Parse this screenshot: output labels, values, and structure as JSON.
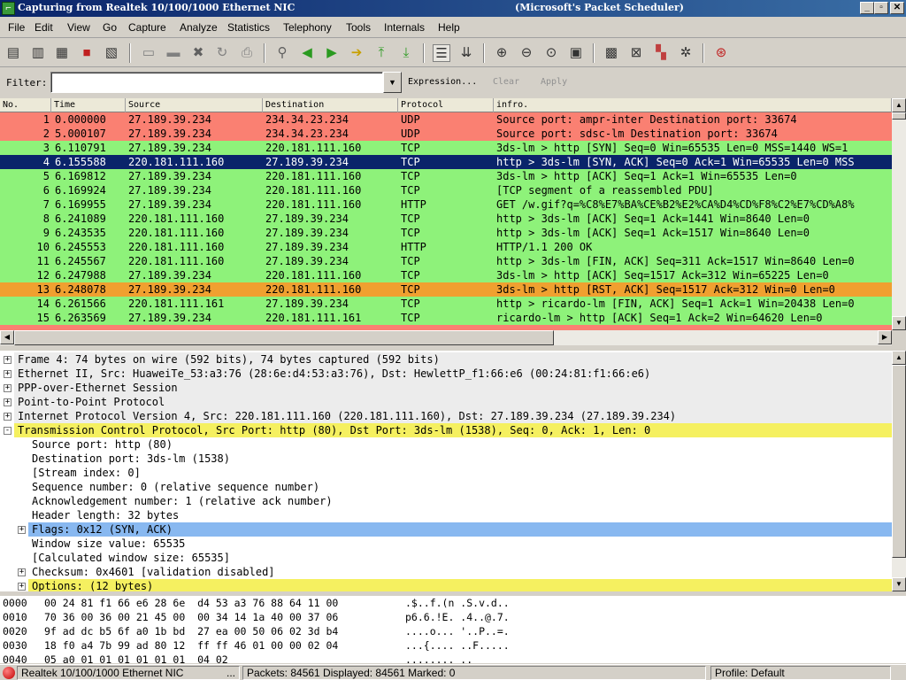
{
  "window": {
    "title": "Capturing from Realtek 10/100/1000 Ethernet NIC",
    "subtitle": "(Microsoft's Packet Scheduler)",
    "minimize": "_",
    "restore": "▫",
    "close": "✕"
  },
  "menu": {
    "file": "File",
    "edit": "Edit",
    "view": "View",
    "go": "Go",
    "capture": "Capture",
    "analyze": "Analyze",
    "statistics": "Statistics",
    "telephony": "Telephony",
    "tools": "Tools",
    "internals": "Internals",
    "help": "Help"
  },
  "filter": {
    "label": "Filter:",
    "value": "",
    "expression": "Expression...",
    "clear": "Clear",
    "apply": "Apply"
  },
  "packet_list": {
    "headers": {
      "no": "No.",
      "time": "Time",
      "source": "Source",
      "destination": "Destination",
      "protocol": "Protocol",
      "info": "infro."
    },
    "rows": [
      {
        "no": "1",
        "time": "0.000000",
        "src": "27.189.39.234",
        "dst": "234.34.23.234",
        "proto": "UDP",
        "info": "Source port: ampr-inter  Destination port: 33674",
        "bg": "#fa8072",
        "fg": "#000000"
      },
      {
        "no": "2",
        "time": "5.000107",
        "src": "27.189.39.234",
        "dst": "234.34.23.234",
        "proto": "UDP",
        "info": "Source port: sdsc-lm  Destination port: 33674",
        "bg": "#fa8072",
        "fg": "#000000"
      },
      {
        "no": "3",
        "time": "6.110791",
        "src": "27.189.39.234",
        "dst": "220.181.111.160",
        "proto": "TCP",
        "info": "3ds-lm > http [SYN] Seq=0 Win=65535 Len=0 MSS=1440 WS=1",
        "bg": "#8ef27a",
        "fg": "#000000"
      },
      {
        "no": "4",
        "time": "6.155588",
        "src": "220.181.111.160",
        "dst": "27.189.39.234",
        "proto": "TCP",
        "info": "http > 3ds-lm [SYN, ACK] Seq=0 Ack=1 Win=65535 Len=0 MSS",
        "bg": "#0a246a",
        "fg": "#ffffff"
      },
      {
        "no": "5",
        "time": "6.169812",
        "src": "27.189.39.234",
        "dst": "220.181.111.160",
        "proto": "TCP",
        "info": "3ds-lm > http [ACK] Seq=1 Ack=1 Win=65535 Len=0",
        "bg": "#8ef27a",
        "fg": "#000000"
      },
      {
        "no": "6",
        "time": "6.169924",
        "src": "27.189.39.234",
        "dst": "220.181.111.160",
        "proto": "TCP",
        "info": "[TCP segment of a reassembled PDU]",
        "bg": "#8ef27a",
        "fg": "#000000"
      },
      {
        "no": "7",
        "time": "6.169955",
        "src": "27.189.39.234",
        "dst": "220.181.111.160",
        "proto": "HTTP",
        "info": "GET /w.gif?q=%C8%E7%BA%CE%B2%E2%CA%D4%CD%F8%C2%E7%CD%A8%",
        "bg": "#8ef27a",
        "fg": "#000000"
      },
      {
        "no": "8",
        "time": "6.241089",
        "src": "220.181.111.160",
        "dst": "27.189.39.234",
        "proto": "TCP",
        "info": "http > 3ds-lm [ACK] Seq=1 Ack=1441 Win=8640 Len=0",
        "bg": "#8ef27a",
        "fg": "#000000"
      },
      {
        "no": "9",
        "time": "6.243535",
        "src": "220.181.111.160",
        "dst": "27.189.39.234",
        "proto": "TCP",
        "info": "http > 3ds-lm [ACK] Seq=1 Ack=1517 Win=8640 Len=0",
        "bg": "#8ef27a",
        "fg": "#000000"
      },
      {
        "no": "10",
        "time": "6.245553",
        "src": "220.181.111.160",
        "dst": "27.189.39.234",
        "proto": "HTTP",
        "info": "HTTP/1.1 200 OK",
        "bg": "#8ef27a",
        "fg": "#000000"
      },
      {
        "no": "11",
        "time": "6.245567",
        "src": "220.181.111.160",
        "dst": "27.189.39.234",
        "proto": "TCP",
        "info": "http > 3ds-lm [FIN, ACK] Seq=311 Ack=1517 Win=8640 Len=0",
        "bg": "#8ef27a",
        "fg": "#000000"
      },
      {
        "no": "12",
        "time": "6.247988",
        "src": "27.189.39.234",
        "dst": "220.181.111.160",
        "proto": "TCP",
        "info": "3ds-lm > http [ACK] Seq=1517 Ack=312 Win=65225 Len=0",
        "bg": "#8ef27a",
        "fg": "#000000"
      },
      {
        "no": "13",
        "time": "6.248078",
        "src": "27.189.39.234",
        "dst": "220.181.111.160",
        "proto": "TCP",
        "info": "3ds-lm > http [RST, ACK] Seq=1517 Ack=312 Win=0 Len=0",
        "bg": "#f0a030",
        "fg": "#000000"
      },
      {
        "no": "14",
        "time": "6.261566",
        "src": "220.181.111.161",
        "dst": "27.189.39.234",
        "proto": "TCP",
        "info": "http > ricardo-lm [FIN, ACK] Seq=1 Ack=1 Win=20438 Len=0",
        "bg": "#8ef27a",
        "fg": "#000000"
      },
      {
        "no": "15",
        "time": "6.263569",
        "src": "27.189.39.234",
        "dst": "220.181.111.161",
        "proto": "TCP",
        "info": "ricardo-lm > http [ACK] Seq=1 Ack=2 Win=64620 Len=0",
        "bg": "#8ef27a",
        "fg": "#000000"
      }
    ]
  },
  "details": [
    {
      "text": "Frame 4: 74 bytes on wire (592 bits), 74 bytes captured (592 bits)",
      "exp": "+",
      "indent": 0,
      "bg": "#ececec"
    },
    {
      "text": "Ethernet II, Src: HuaweiTe_53:a3:76 (28:6e:d4:53:a3:76), Dst: HewlettP_f1:66:e6 (00:24:81:f1:66:e6)",
      "exp": "+",
      "indent": 0,
      "bg": "#ececec"
    },
    {
      "text": "PPP-over-Ethernet Session",
      "exp": "+",
      "indent": 0,
      "bg": "#ececec"
    },
    {
      "text": "Point-to-Point Protocol",
      "exp": "+",
      "indent": 0,
      "bg": "#ececec"
    },
    {
      "text": "Internet Protocol Version 4, Src: 220.181.111.160 (220.181.111.160), Dst: 27.189.39.234 (27.189.39.234)",
      "exp": "+",
      "indent": 0,
      "bg": "#ececec"
    },
    {
      "text": "Transmission Control Protocol, Src Port: http (80), Dst Port: 3ds-lm (1538), Seq: 0, Ack: 1, Len: 0",
      "exp": "-",
      "indent": 0,
      "bg": "#f5f060"
    },
    {
      "text": "Source port: http (80)",
      "exp": "",
      "indent": 1,
      "bg": "#ffffff"
    },
    {
      "text": "Destination port: 3ds-lm (1538)",
      "exp": "",
      "indent": 1,
      "bg": "#ffffff"
    },
    {
      "text": "[Stream index: 0]",
      "exp": "",
      "indent": 1,
      "bg": "#ffffff"
    },
    {
      "text": "Sequence number: 0    (relative sequence number)",
      "exp": "",
      "indent": 1,
      "bg": "#ffffff"
    },
    {
      "text": "Acknowledgement number: 1    (relative ack number)",
      "exp": "",
      "indent": 1,
      "bg": "#ffffff"
    },
    {
      "text": "Header length: 32 bytes",
      "exp": "",
      "indent": 1,
      "bg": "#ffffff"
    },
    {
      "text": "Flags: 0x12 (SYN, ACK)",
      "exp": "+",
      "indent": 1,
      "bg": "#88b8f0"
    },
    {
      "text": "Window size value: 65535",
      "exp": "",
      "indent": 1,
      "bg": "#ffffff"
    },
    {
      "text": "[Calculated window size: 65535]",
      "exp": "",
      "indent": 1,
      "bg": "#ffffff"
    },
    {
      "text": "Checksum: 0x4601 [validation disabled]",
      "exp": "+",
      "indent": 1,
      "bg": "#ffffff"
    },
    {
      "text": "Options: (12 bytes)",
      "exp": "+",
      "indent": 1,
      "bg": "#f5f060"
    }
  ],
  "hex": [
    {
      "offset": "0000",
      "bytes": "00 24 81 f1 66 e6 28 6e  d4 53 a3 76 88 64 11 00",
      "ascii": ".$..f.(n .S.v.d.."
    },
    {
      "offset": "0010",
      "bytes": "70 36 00 36 00 21 45 00  00 34 14 1a 40 00 37 06",
      "ascii": "p6.6.!E. .4..@.7."
    },
    {
      "offset": "0020",
      "bytes": "9f ad dc b5 6f a0 1b bd  27 ea 00 50 06 02 3d b4",
      "ascii": "....o... '..P..=."
    },
    {
      "offset": "0030",
      "bytes": "18 f0 a4 7b 99 ad 80 12  ff ff 46 01 00 00 02 04",
      "ascii": "...{.... ..F....."
    },
    {
      "offset": "0040",
      "bytes": "05 a0 01 01 01 01 01 01  04 02",
      "ascii": "........ .."
    }
  ],
  "status": {
    "interface": "Realtek 10/100/1000 Ethernet NIC",
    "ellipsis": "...",
    "packets": "Packets: 84561 Displayed: 84561 Marked: 0",
    "profile": "Profile: Default"
  }
}
